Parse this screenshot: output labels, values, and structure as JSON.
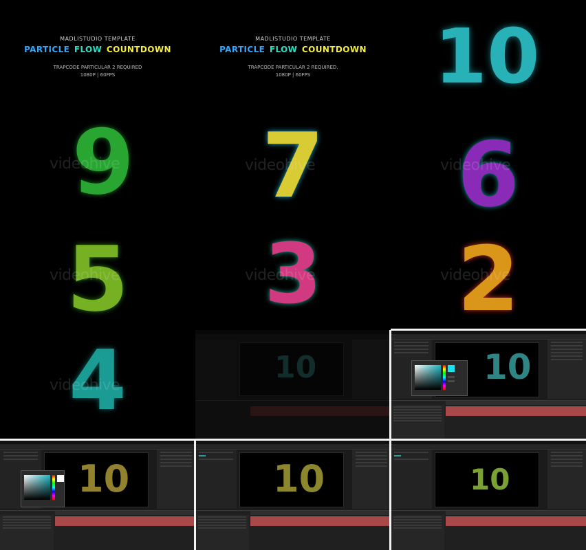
{
  "header_panels": [
    {
      "studio": "MADLISTUDIO TEMPLATE",
      "title_words": [
        {
          "text": "PARTICLE",
          "color": "#2ea8ff"
        },
        {
          "text": "FLOW",
          "color": "#27e0c4"
        },
        {
          "text": "COUNTDOWN",
          "color": "#f4ee3c"
        }
      ],
      "requirement": "TRAPCODE PARTICULAR 2 REQUIRED",
      "format": "1080P | 60FPS"
    },
    {
      "studio": "MADLISTUDIO TEMPLATE",
      "title_words": [
        {
          "text": "PARTICLE",
          "color": "#2ea8ff"
        },
        {
          "text": "FLOW",
          "color": "#27e0c4"
        },
        {
          "text": "COUNTDOWN",
          "color": "#f4ee3c"
        }
      ],
      "requirement": "TRAPCODE PARTICULAR 2 REQUIRED.",
      "format": "1080P | 60FPS"
    }
  ],
  "digits": [
    {
      "value": "9",
      "color": "#2fc43a"
    },
    {
      "value": "5",
      "color": "#8ad12a"
    },
    {
      "value": "4",
      "color": "#1fb7ae"
    },
    {
      "value": "7",
      "color": "#f0e23a"
    },
    {
      "value": "3",
      "color": "#e8408e"
    },
    {
      "value": "10",
      "color": "#2fd0d8"
    },
    {
      "value": "6",
      "color": "#a233d8"
    },
    {
      "value": "2",
      "color": "#f2a71c"
    }
  ],
  "watermark": "videohive",
  "ae_digits": [
    {
      "value": "10",
      "color": "#d8d84a"
    },
    {
      "value": "10",
      "color": "#d0b840"
    },
    {
      "value": "10",
      "color": "#3fa0a0"
    },
    {
      "value": "10",
      "color": "#8fbf3a"
    }
  ]
}
